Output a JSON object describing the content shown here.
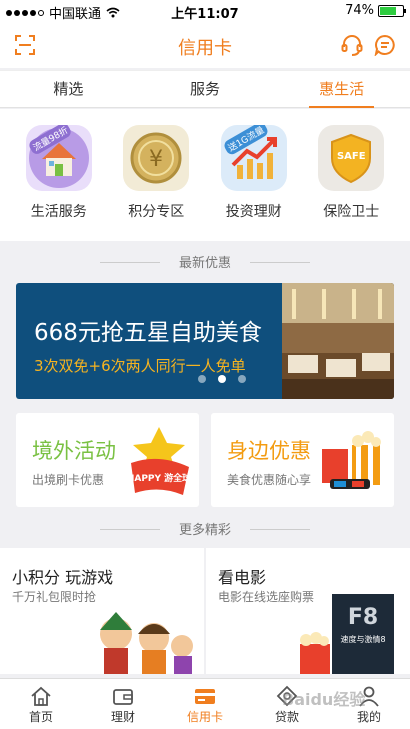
{
  "status_bar": {
    "carrier": "中国联通",
    "time": "上午11:07",
    "battery_text": "74%",
    "battery_level": 0.74
  },
  "header": {
    "title": "信用卡"
  },
  "tabs": [
    {
      "label": "精选"
    },
    {
      "label": "服务"
    },
    {
      "label": "惠生活"
    }
  ],
  "quick_links": [
    {
      "label": "生活服务",
      "icon": "house-icon",
      "badge": "流量98折",
      "color": "#a98ad9"
    },
    {
      "label": "积分专区",
      "icon": "yuan-coin-icon",
      "badge": "",
      "color": "#c9a64a"
    },
    {
      "label": "投资理财",
      "icon": "chart-up-icon",
      "badge": "送1G流量",
      "color": "#5aa7e8"
    },
    {
      "label": "保险卫士",
      "icon": "safe-shield-icon",
      "badge": "SAFE",
      "color": "#f3b322"
    }
  ],
  "latest_section": {
    "title": "最新优惠"
  },
  "banner": {
    "title": "668元抢五星自助美食",
    "subtitle": "3次双免+6次两人同行一人免单",
    "pages": 3,
    "active_page": 2
  },
  "promos": [
    {
      "title": "境外活动",
      "subtitle": "出境刷卡优惠",
      "art_text": "HAPPY 游全球",
      "color": "#7ac143"
    },
    {
      "title": "身边优惠",
      "subtitle": "美食优惠随心享",
      "color": "#f39c12"
    }
  ],
  "more_section": {
    "title": "更多精彩"
  },
  "more_cards": [
    {
      "title": "小积分 玩游戏",
      "subtitle": "千万礼包限时抢"
    },
    {
      "title": "看电影",
      "subtitle": "电影在线选座购票",
      "poster_text": "速度与激情8"
    }
  ],
  "tab_bar": [
    {
      "label": "首页",
      "icon": "home-icon"
    },
    {
      "label": "理财",
      "icon": "wallet-icon"
    },
    {
      "label": "信用卡",
      "icon": "credit-card-icon",
      "active": true
    },
    {
      "label": "贷款",
      "icon": "loan-icon"
    },
    {
      "label": "我的",
      "icon": "user-icon"
    }
  ],
  "watermark": "Baidu经验",
  "colors": {
    "accent": "#f07e1f",
    "banner_bg": "#0f4f7d",
    "banner_subtitle": "#f5b320"
  }
}
